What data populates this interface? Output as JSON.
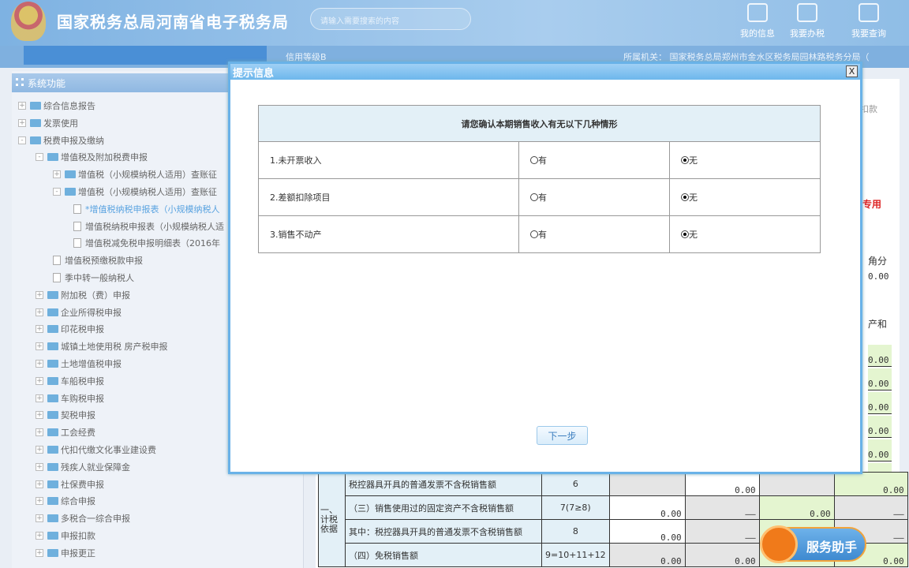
{
  "header": {
    "title": "国家税务总局河南省电子税务局",
    "search_placeholder": "请输入需要搜索的内容",
    "nav": [
      {
        "label": "我的信息",
        "icon": "user-icon"
      },
      {
        "label": "我要办税",
        "icon": "monitor-icon"
      },
      {
        "label": "我要查询",
        "icon": "query-icon"
      }
    ]
  },
  "subbar": {
    "credit": "信用等级B",
    "org": "所属机关：  国家税务总局郑州市金水区税务局园林路税务分局（"
  },
  "sidebar": {
    "title": "系统功能",
    "items": [
      {
        "label": "综合信息报告",
        "level": 0,
        "type": "folder",
        "exp": "+"
      },
      {
        "label": "发票使用",
        "level": 0,
        "type": "folder",
        "exp": "+"
      },
      {
        "label": "税费申报及缴纳",
        "level": 0,
        "type": "folder",
        "exp": "-"
      },
      {
        "label": "增值税及附加税费申报",
        "level": 1,
        "type": "folder",
        "exp": "-"
      },
      {
        "label": "增值税（小规模纳税人适用）查账征",
        "level": 2,
        "type": "folder",
        "exp": "+"
      },
      {
        "label": "增值税（小规模纳税人适用）查账征",
        "level": 2,
        "type": "folder",
        "exp": "-"
      },
      {
        "label": "*增值税纳税申报表（小规模纳税人",
        "level": 3,
        "type": "doc",
        "active": true
      },
      {
        "label": "增值税纳税申报表（小规模纳税人适",
        "level": 3,
        "type": "doc"
      },
      {
        "label": "增值税减免税申报明细表（2016年",
        "level": 3,
        "type": "doc"
      },
      {
        "label": "增值税预缴税款申报",
        "level": 2,
        "type": "doc"
      },
      {
        "label": "季中转一般纳税人",
        "level": 2,
        "type": "doc"
      },
      {
        "label": "附加税（费）申报",
        "level": 1,
        "type": "folder",
        "exp": "+"
      },
      {
        "label": "企业所得税申报",
        "level": 1,
        "type": "folder",
        "exp": "+"
      },
      {
        "label": "印花税申报",
        "level": 1,
        "type": "folder",
        "exp": "+"
      },
      {
        "label": "城镇土地使用税 房产税申报",
        "level": 1,
        "type": "folder",
        "exp": "+"
      },
      {
        "label": "土地增值税申报",
        "level": 1,
        "type": "folder",
        "exp": "+"
      },
      {
        "label": "车船税申报",
        "level": 1,
        "type": "folder",
        "exp": "+"
      },
      {
        "label": "车购税申报",
        "level": 1,
        "type": "folder",
        "exp": "+"
      },
      {
        "label": "契税申报",
        "level": 1,
        "type": "folder",
        "exp": "+"
      },
      {
        "label": "工会经费",
        "level": 1,
        "type": "folder",
        "exp": "+"
      },
      {
        "label": "代扣代缴文化事业建设费",
        "level": 1,
        "type": "folder",
        "exp": "+"
      },
      {
        "label": "残疾人就业保障金",
        "level": 1,
        "type": "folder",
        "exp": "+"
      },
      {
        "label": "社保费申报",
        "level": 1,
        "type": "folder",
        "exp": "+"
      },
      {
        "label": "综合申报",
        "level": 1,
        "type": "folder",
        "exp": "+"
      },
      {
        "label": "多税合一综合申报",
        "level": 1,
        "type": "folder",
        "exp": "+"
      },
      {
        "label": "申报扣款",
        "level": 1,
        "type": "folder",
        "exp": "+"
      },
      {
        "label": "申报更正",
        "level": 1,
        "type": "folder",
        "exp": "+"
      }
    ]
  },
  "dialog": {
    "title": "提示信息",
    "close": "X",
    "question": "请您确认本期销售收入有无以下几种情形",
    "yes": "有",
    "no": "无",
    "rows": [
      {
        "label": "1.未开票收入",
        "selected": "无"
      },
      {
        "label": "2.差额扣除项目",
        "selected": "无"
      },
      {
        "label": "3.销售不动产",
        "selected": "无"
      }
    ],
    "next": "下一步"
  },
  "background": {
    "right_labels": {
      "tab": "扣款",
      "red": "专用",
      "unit": "角分",
      "r1": "0.00",
      "col": "产和",
      "vals": [
        "0.00",
        "0.00",
        "0.00",
        "0.00",
        "0.00",
        "0.00"
      ]
    },
    "section": "一、计税依据",
    "rows": [
      {
        "label": "税控器具开具的普通发票不含税销售额",
        "no": "6",
        "c": [
          "",
          "0.00",
          "",
          "0.00"
        ]
      },
      {
        "label": "（三）销售使用过的固定资产不含税销售额",
        "no": "7(7≥8)",
        "c": [
          "0.00",
          "——",
          "0.00",
          "——"
        ]
      },
      {
        "label": "其中：税控器具开具的普通发票不含税销售额",
        "no": "8",
        "c": [
          "0.00",
          "——",
          "0.00",
          "——"
        ]
      },
      {
        "label": "（四）免税销售额",
        "no": "9=10+11+12",
        "c": [
          "0.00",
          "0.00",
          "",
          "0.00"
        ]
      }
    ]
  },
  "helper": {
    "label": "服务助手"
  }
}
